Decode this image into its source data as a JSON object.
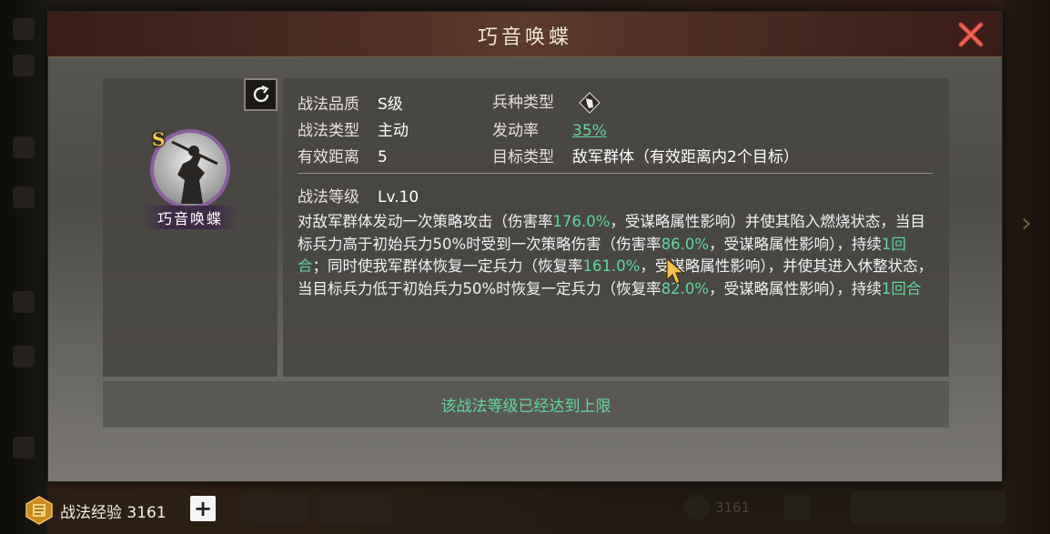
{
  "dialog": {
    "title": "巧音唤蝶",
    "close_icon": "close-x-icon",
    "accent_red": "#c9473a"
  },
  "portrait": {
    "grade": "S",
    "name": "巧音唤蝶",
    "refresh_icon": "refresh-icon",
    "ring_color": "#8b5fa0"
  },
  "info": {
    "quality_label": "战法品质",
    "quality_value": "S级",
    "troop_type_label": "兵种类型",
    "troop_type_icon": "cavalry-unit-icon",
    "type_label": "战法类型",
    "type_value": "主动",
    "trigger_rate_label": "发动率",
    "trigger_rate_value": "35%",
    "range_label": "有效距离",
    "range_value": "5",
    "target_label": "目标类型",
    "target_value": "敌军群体（有效距离内2个目标）",
    "level_label": "战法等级",
    "level_value": "Lv.10"
  },
  "description": {
    "p1": "对敌军群体发动一次策略攻击（伤害率",
    "h1": "176.0%",
    "p2": "，受谋略属性影响）并使其陷入燃烧状态，当目标兵力高于初始兵力50%时受到一次策略伤害（伤害率",
    "h2": "86.0%",
    "p3": "，受谋略属性影响），持续",
    "h3": "1回合",
    "p4": "；同时使我军群体恢复一定兵力（恢复率",
    "h4": "161.0%",
    "p5": "，受谋略属性影响），并使其进入休整状态，当目标兵力低于初始兵力50%时恢复一定兵力（恢复率",
    "h5": "82.0%",
    "p6": "，受谋略属性影响），持续",
    "h6": "1回合",
    "highlight_color": "#5fd79c"
  },
  "max_level_notice": "该战法等级已经达到上限",
  "footer": {
    "exp_icon": "tactic-exp-icon",
    "exp_label": "战法经验",
    "exp_value": "3161",
    "add_icon": "plus-icon",
    "bg_value": "3161"
  }
}
